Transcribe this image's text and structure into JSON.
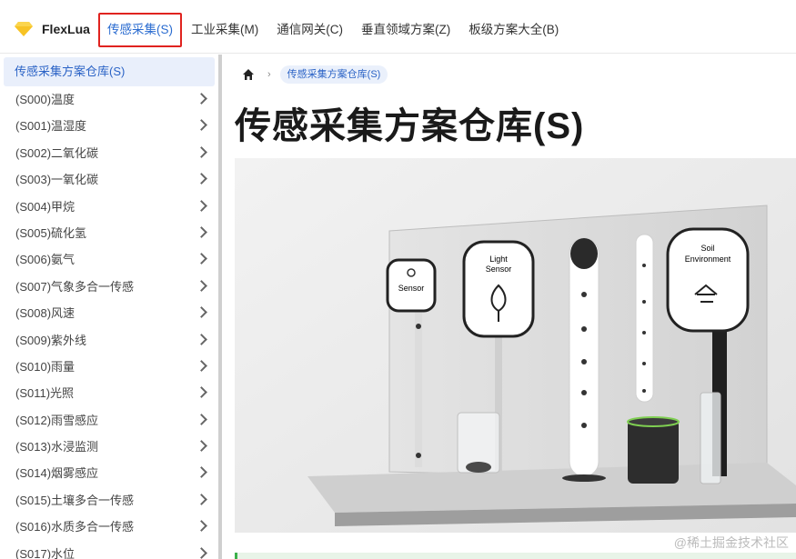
{
  "brand": {
    "name": "FlexLua",
    "logo_icon": "diamond-logo-icon",
    "logo_color": "#f7c325"
  },
  "nav": {
    "items": [
      {
        "label": "传感采集(S)",
        "active": true
      },
      {
        "label": "工业采集(M)"
      },
      {
        "label": "通信网关(C)"
      },
      {
        "label": "垂直领域方案(Z)"
      },
      {
        "label": "板级方案大全(B)"
      }
    ]
  },
  "sidebar": {
    "header": "传感采集方案仓库(S)",
    "items": [
      {
        "label": "(S000)温度"
      },
      {
        "label": "(S001)温湿度"
      },
      {
        "label": "(S002)二氧化碳"
      },
      {
        "label": "(S003)一氧化碳"
      },
      {
        "label": "(S004)甲烷"
      },
      {
        "label": "(S005)硫化氢"
      },
      {
        "label": "(S006)氨气"
      },
      {
        "label": "(S007)气象多合一传感"
      },
      {
        "label": "(S008)风速"
      },
      {
        "label": "(S009)紫外线"
      },
      {
        "label": "(S010)雨量"
      },
      {
        "label": "(S011)光照"
      },
      {
        "label": "(S012)雨雪感应"
      },
      {
        "label": "(S013)水浸监测"
      },
      {
        "label": "(S014)烟雾感应"
      },
      {
        "label": "(S015)土壤多合一传感"
      },
      {
        "label": "(S016)水质多合一传感"
      },
      {
        "label": "(S017)水位"
      }
    ]
  },
  "breadcrumb": {
    "home_icon": "home-icon",
    "current": "传感采集方案仓库(S)"
  },
  "page": {
    "title": "传感采集方案仓库(S)"
  },
  "hero": {
    "labels": {
      "sensor": "Sensor",
      "light_line1": "Light",
      "light_line2": "Sensor",
      "soil_line1": "Soil",
      "soil_line2": "Environment"
    }
  },
  "watermark": "@稀土掘金技术社区",
  "colors": {
    "accent": "#2b63c6",
    "highlight_border": "#e0231f",
    "sidebar_active_bg": "#e9effb"
  }
}
